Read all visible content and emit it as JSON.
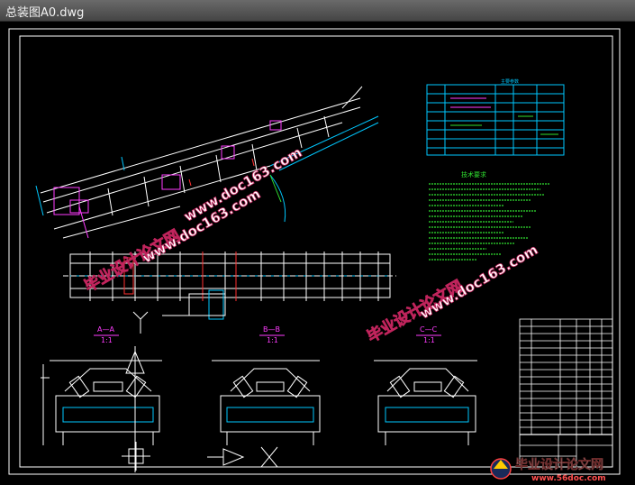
{
  "window": {
    "title": "总装图A0.dwg"
  },
  "drawing": {
    "section_labels": [
      {
        "name": "A—A",
        "scale": "1:1"
      },
      {
        "name": "B—B",
        "scale": "1:1"
      },
      {
        "name": "C—C",
        "scale": "1:1"
      }
    ],
    "tech_requirements_title": "技术要求",
    "tech_spec_box_title": "主要参数"
  },
  "watermarks": {
    "cn_text": "毕业设计论文网",
    "url_text": "www.doc163.com",
    "footer_cn": "毕业设计论文网",
    "footer_url": "www.56doc.com"
  },
  "colors": {
    "lines": "#ffffff",
    "cyan": "#00c8ff",
    "green": "#30e030",
    "magenta": "#ff3cff",
    "red": "#ff3030",
    "watermark_fill": "#ffffff",
    "watermark_stroke": "#c0245c"
  }
}
